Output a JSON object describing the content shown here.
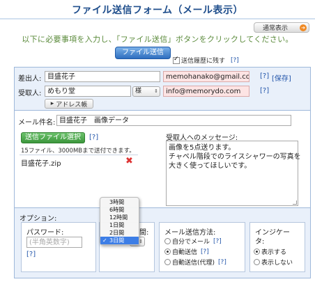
{
  "header": {
    "title": "ファイル送信フォーム（メール表示）",
    "mode_button": "通常表示",
    "mode_arrow": "➔",
    "instruction": "以下に必要事項を入力し、「ファイル送信」ボタンをクリックしてください。",
    "send_button": "ファイル送信",
    "history_label": "送信履歴に残す",
    "help": "[?]"
  },
  "sender": {
    "label": "差出人:",
    "name": "目盛花子",
    "email": "memohanako@gmail.com",
    "help": "[?]",
    "save": "[保存]"
  },
  "recipient": {
    "label": "受取人:",
    "name": "めもり堂",
    "honorific": "様",
    "email": "info@memorydo.com",
    "help": "[?]",
    "address_book_icon": "chevron-right-icon",
    "address_book_glyph": "▸",
    "address_book": "アドレス帳"
  },
  "subject": {
    "label": "メール件名:",
    "value": "目盛花子　画像データ"
  },
  "files": {
    "select_button": "送信ファイル選択",
    "help": "[?]",
    "limit_note": "15ファイル、3000MBまで送付できます。",
    "items": [
      "目盛花子.zip"
    ],
    "remove_icon": "✖"
  },
  "message": {
    "label": "受取人へのメッセージ:",
    "lines": [
      "画像を5点送ります。",
      "チャペル階段でのライスシャワーの写真を",
      "大きく使ってほしいです。"
    ]
  },
  "options": {
    "label": "オプション:",
    "password": {
      "label": "パスワード:",
      "placeholder": "(半角英数字)",
      "help": "[?]"
    },
    "period": {
      "label_partial": "間:",
      "options": [
        "3時間",
        "6時間",
        "12時間",
        "1日間",
        "2日間",
        "3日間"
      ],
      "selected": "3日間",
      "check": "✓",
      "caret": "⇕"
    },
    "mail_method": {
      "label": "メール送信方法:",
      "items": [
        {
          "label": "自分でメール",
          "help": "[?]",
          "selected": false
        },
        {
          "label": "自動送信",
          "help": "[?]",
          "selected": true
        },
        {
          "label": "自動送信(代理)",
          "help": "[?]",
          "selected": false
        }
      ]
    },
    "indicator": {
      "label_line1": "インジケー",
      "label_line2": "タ:",
      "items": [
        {
          "label": "表示する",
          "selected": true
        },
        {
          "label": "表示しない",
          "selected": false
        }
      ]
    }
  }
}
